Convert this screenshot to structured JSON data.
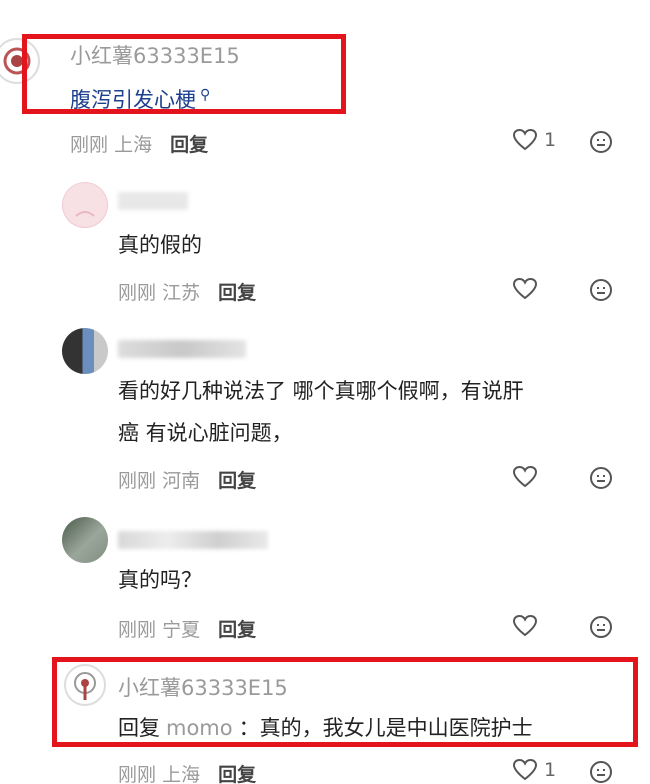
{
  "comments": [
    {
      "username": "小红薯63333E15",
      "text": "腹泻引发心梗",
      "time": "刚刚",
      "location": "上海",
      "reply_label": "回复",
      "likes": "1"
    },
    {
      "text": "真的假的",
      "time": "刚刚",
      "location": "江苏",
      "reply_label": "回复"
    },
    {
      "text_line1": "看的好几种说法了 哪个真哪个假啊，有说肝",
      "text_line2": "癌 有说心脏问题，",
      "time": "刚刚",
      "location": "河南",
      "reply_label": "回复"
    },
    {
      "text": "真的吗？",
      "time": "刚刚",
      "location": "宁夏",
      "reply_label": "回复"
    },
    {
      "username": "小红薯63333E15",
      "reply_prefix": "回复",
      "reply_to": "momo",
      "text": "：真的，我女儿是中山医院护士",
      "time": "刚刚",
      "location": "上海",
      "reply_label": "回复",
      "likes": "1"
    }
  ],
  "colors": {
    "highlight": "#e3141c",
    "topic_link": "#1c3f8e",
    "muted_text": "#9a9a9a"
  },
  "icons": [
    "heart-icon",
    "emoji-reply-icon",
    "search-icon"
  ]
}
